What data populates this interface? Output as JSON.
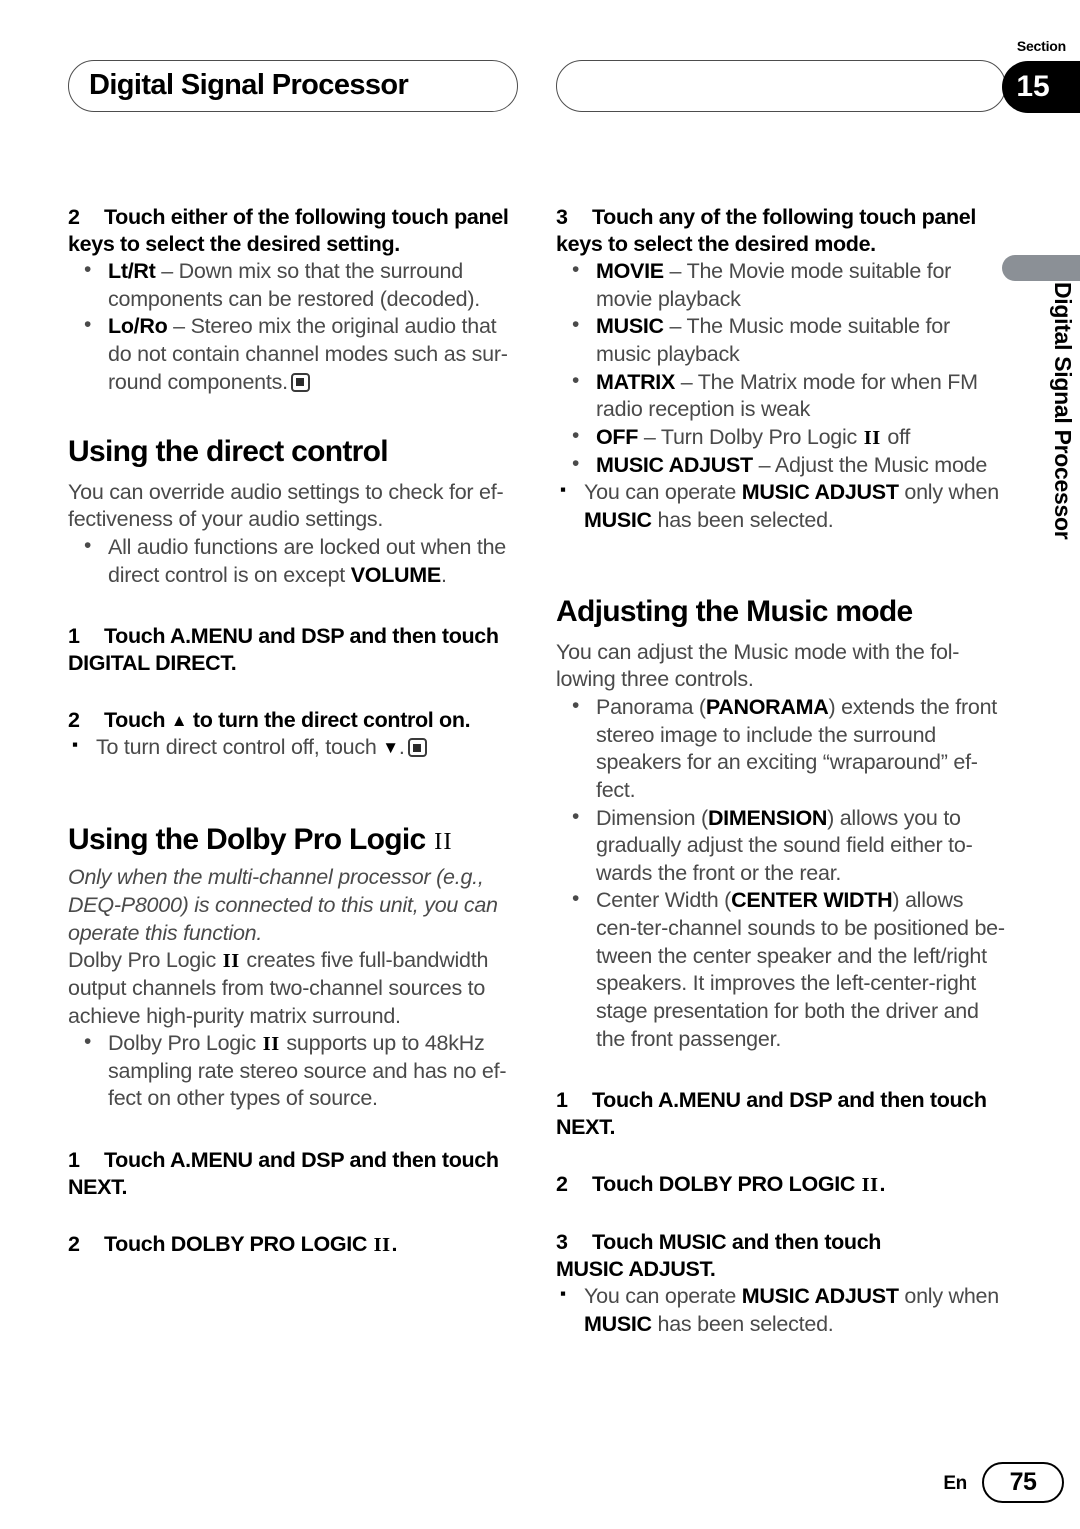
{
  "header": {
    "chapter_title": "Digital Signal Processor",
    "right_box_title": "",
    "section_word": "Section",
    "section_number": "15"
  },
  "side_tab": {
    "label": "Digital Signal Processor"
  },
  "left_column": {
    "step2": {
      "num": "2",
      "text": "Touch either of the following touch panel keys to select the desired setting."
    },
    "step2_bullets": [
      {
        "term": "Lt/Rt",
        "desc": "– Down mix so that the surround components can be restored (decoded)."
      },
      {
        "term": "Lo/Ro",
        "desc": "– Stereo mix the original audio that do not contain channel modes such as sur-round components."
      }
    ],
    "direct_control": {
      "heading": "Using the direct control",
      "intro": "You can override audio settings to check for ef-fectiveness of your audio settings.",
      "bullet_part1": "All audio functions are locked out when the direct control is on except ",
      "bullet_bold": "VOLUME",
      "bullet_part2": ".",
      "step1_num": "1",
      "step1_line1": "Touch A.MENU and DSP and then touch",
      "step1_line2": "DIGITAL DIRECT.",
      "step2_num": "2",
      "step2_a": "Touch ",
      "step2_b": " to turn the direct control on.",
      "note_a": "To turn direct control off, touch ",
      "note_b": "."
    },
    "dolby": {
      "heading_main": "Using the Dolby Pro Logic ",
      "heading_mark": "II",
      "italic_note": "Only when the multi-channel processor (e.g., DEQ-P8000) is connected to this unit, you can operate this function.",
      "body_a": "Dolby Pro Logic ",
      "body_mark": "II",
      "body_b": " creates five full-bandwidth output channels from two-channel sources to achieve high-purity matrix surround.",
      "bullet_a": "Dolby Pro Logic ",
      "bullet_mark": "II",
      "bullet_b": " supports up to 48kHz sampling rate stereo source and has no ef-fect on other types of source.",
      "step1_num": "1",
      "step1_line1": "Touch A.MENU and DSP and then touch",
      "step1_line2": "NEXT.",
      "step2_num": "2",
      "step2_a": "Touch DOLBY PRO LOGIC ",
      "step2_mark": "II",
      "step2_b": "."
    }
  },
  "right_column": {
    "step3": {
      "num": "3",
      "text": "Touch any of the following touch panel keys to select the desired mode."
    },
    "step3_bullets": [
      {
        "term": "MOVIE",
        "desc": "– The Movie mode suitable for movie playback",
        "mark": ""
      },
      {
        "term": "MUSIC",
        "desc": "– The Music mode suitable for music playback",
        "mark": ""
      },
      {
        "term": "MATRIX",
        "desc": "– The Matrix mode for when FM radio reception is weak",
        "mark": ""
      },
      {
        "term": "OFF",
        "desc_a": "– Turn Dolby Pro Logic ",
        "mark": "II",
        "desc_b": " off"
      },
      {
        "term": "MUSIC ADJUST",
        "desc": "– Adjust the Music mode",
        "mark": ""
      }
    ],
    "note1": {
      "a": "You can operate ",
      "bold1": "MUSIC ADJUST",
      "b": " only when ",
      "bold2": "MUSIC",
      "c": " has been selected."
    },
    "music_mode": {
      "heading": "Adjusting the Music mode",
      "intro": "You can adjust the Music mode with the fol-lowing three controls.",
      "bullets": [
        {
          "a": "Panorama (",
          "bold": "PANORAMA",
          "b": ") extends the front stereo image to include the surround speakers for an exciting “wraparound” ef-fect."
        },
        {
          "a": "Dimension (",
          "bold": "DIMENSION",
          "b": ") allows you to gradually adjust the sound field either to-wards the front or the rear."
        },
        {
          "a": "Center Width (",
          "bold": "CENTER WIDTH",
          "b": ") allows cen-ter-channel sounds to be positioned be-tween the center speaker and the left/right speakers. It improves the left-center-right stage presentation for both the driver and the front passenger."
        }
      ],
      "step1_num": "1",
      "step1_line1": "Touch A.MENU and DSP and then touch",
      "step1_line2": "NEXT.",
      "step2_num": "2",
      "step2_a": "Touch DOLBY PRO LOGIC ",
      "step2_mark": "II",
      "step2_b": ".",
      "step3_num": "3",
      "step3_line1": "Touch MUSIC and then touch",
      "step3_line2": "MUSIC ADJUST.",
      "note": {
        "a": "You can operate ",
        "bold1": "MUSIC ADJUST",
        "b": " only when ",
        "bold2": "MUSIC",
        "c": " has been selected."
      }
    }
  },
  "footer": {
    "language": "En",
    "page_number": "75"
  }
}
